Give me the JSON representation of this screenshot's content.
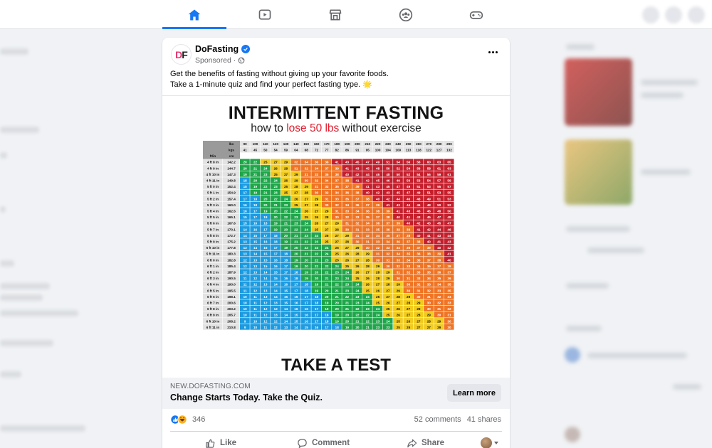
{
  "nav": {
    "tabs": [
      {
        "name": "home-icon",
        "active": true
      },
      {
        "name": "watch-icon",
        "active": false
      },
      {
        "name": "marketplace-icon",
        "active": false
      },
      {
        "name": "groups-icon",
        "active": false
      },
      {
        "name": "gaming-icon",
        "active": false
      }
    ]
  },
  "post": {
    "page_name": "DoFasting",
    "avatar_initials": {
      "d": "D",
      "f": "F"
    },
    "sponsored_label": "Sponsored ·",
    "text_line1": "Get the benefits of fasting without giving up your favorite foods.",
    "text_line2": "Take a 1-minute quiz and find your perfect fasting type. 🌟",
    "more_icon": "ellipsis-icon",
    "privacy_icon": "globe-icon"
  },
  "ad": {
    "title": "INTERMITTENT FASTING",
    "subtitle_before": "how to ",
    "subtitle_red": "lose 50 lbs",
    "subtitle_after": " without exercise",
    "cta_text": "TAKE A TEST"
  },
  "bmi_table": {
    "lbs_label": "lbs",
    "kgs_label": "kgs",
    "ft_label": "ft/in",
    "cm_label": "cm",
    "lbs": [
      90,
      100,
      110,
      120,
      130,
      140,
      150,
      160,
      170,
      180,
      190,
      200,
      210,
      220,
      230,
      240,
      250,
      260,
      270,
      280,
      290
    ],
    "kgs": [
      41,
      45,
      50,
      54,
      59,
      64,
      68,
      72,
      77,
      82,
      86,
      91,
      95,
      100,
      104,
      109,
      113,
      118,
      122,
      127,
      132
    ],
    "heights_ft": [
      "4 ft 8 in",
      "4 ft 9 in",
      "4 ft 10 in",
      "4 ft 11 in",
      "5 ft 0 in",
      "5 ft 1 in",
      "5 ft 2 in",
      "5 ft 3 in",
      "5 ft 4 in",
      "5 ft 5 in",
      "5 ft 6 in",
      "5 ft 7 in",
      "5 ft 8 in",
      "5 ft 9 in",
      "5 ft 10 in",
      "5 ft 11 in",
      "6 ft 0 in",
      "6 ft 1 in",
      "6 ft 2 in",
      "6 ft 3 in",
      "6 ft 4 in",
      "6 ft 5 in",
      "6 ft 6 in",
      "6 ft 7 in",
      "6 ft 8 in",
      "6 ft 9 in",
      "6 ft 10 in",
      "6 ft 11 in"
    ],
    "heights_cm": [
      "142.2",
      "144.7",
      "147.3",
      "149.8",
      "152.4",
      "154.9",
      "157.4",
      "160.0",
      "162.5",
      "165.1",
      "167.6",
      "170.1",
      "172.7",
      "175.2",
      "177.8",
      "180.3",
      "182.8",
      "185.4",
      "187.9",
      "190.5",
      "193.0",
      "195.5",
      "198.1",
      "200.6",
      "203.2",
      "205.7",
      "208.2",
      "210.8"
    ],
    "colors": {
      "blue": "#1c9be0",
      "green": "#1fa64a",
      "yellow": "#f1cb1f",
      "orange": "#ef7424",
      "red": "#c41f2c",
      "header": "#e3e3e3",
      "header_dark": "#9a9a9a"
    }
  },
  "link": {
    "domain": "NEW.DOFASTING.COM",
    "headline": "Change Starts Today. Take the Quiz.",
    "button": "Learn more"
  },
  "stats": {
    "reactions": "346",
    "comments": "52 comments",
    "shares": "41 shares"
  },
  "actions": {
    "like": "Like",
    "comment": "Comment",
    "share": "Share"
  }
}
